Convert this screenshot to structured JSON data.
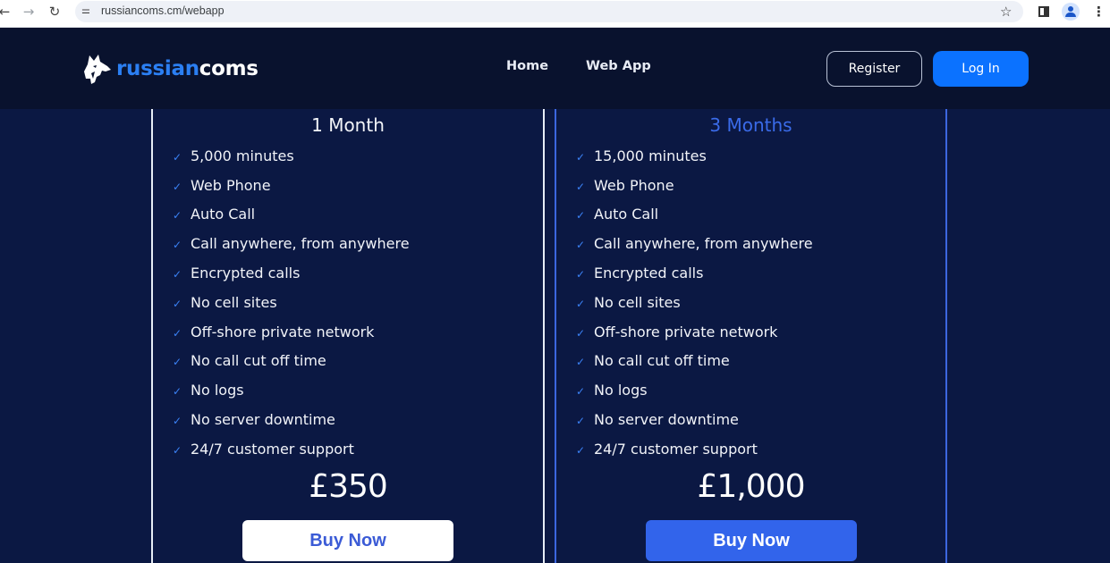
{
  "browser": {
    "url": "russiancoms.cm/webapp",
    "icons": {
      "back": "arrow-left-icon",
      "forward": "arrow-right-icon",
      "reload": "reload-icon",
      "site_info": "tune-icon",
      "bookmark": "star-icon",
      "side_panel": "side-panel-icon",
      "profile": "profile-icon",
      "menu": "more-vert-icon"
    }
  },
  "header": {
    "brand_part1": "russian",
    "brand_part2": "coms",
    "nav": [
      {
        "label": "Home"
      },
      {
        "label": "Web App"
      }
    ],
    "register_label": "Register",
    "login_label": "Log In"
  },
  "colors": {
    "accent": "#0b72ff",
    "background": "#0b1843",
    "header_bg": "#09122e",
    "highlight_title": "#3a6be9"
  },
  "plans": [
    {
      "title": "1 Month",
      "features": [
        "5,000 minutes",
        "Web Phone",
        "Auto Call",
        "Call anywhere, from anywhere",
        "Encrypted calls",
        "No cell sites",
        "Off-shore private network",
        "No call cut off time",
        "No logs",
        "No server downtime",
        "24/7 customer support"
      ],
      "price": "£350",
      "button_label": "Buy Now"
    },
    {
      "title": "3 Months",
      "features": [
        "15,000 minutes",
        "Web Phone",
        "Auto Call",
        "Call anywhere, from anywhere",
        "Encrypted calls",
        "No cell sites",
        "Off-shore private network",
        "No call cut off time",
        "No logs",
        "No server downtime",
        "24/7 customer support"
      ],
      "price": "£1,000",
      "button_label": "Buy Now"
    }
  ]
}
